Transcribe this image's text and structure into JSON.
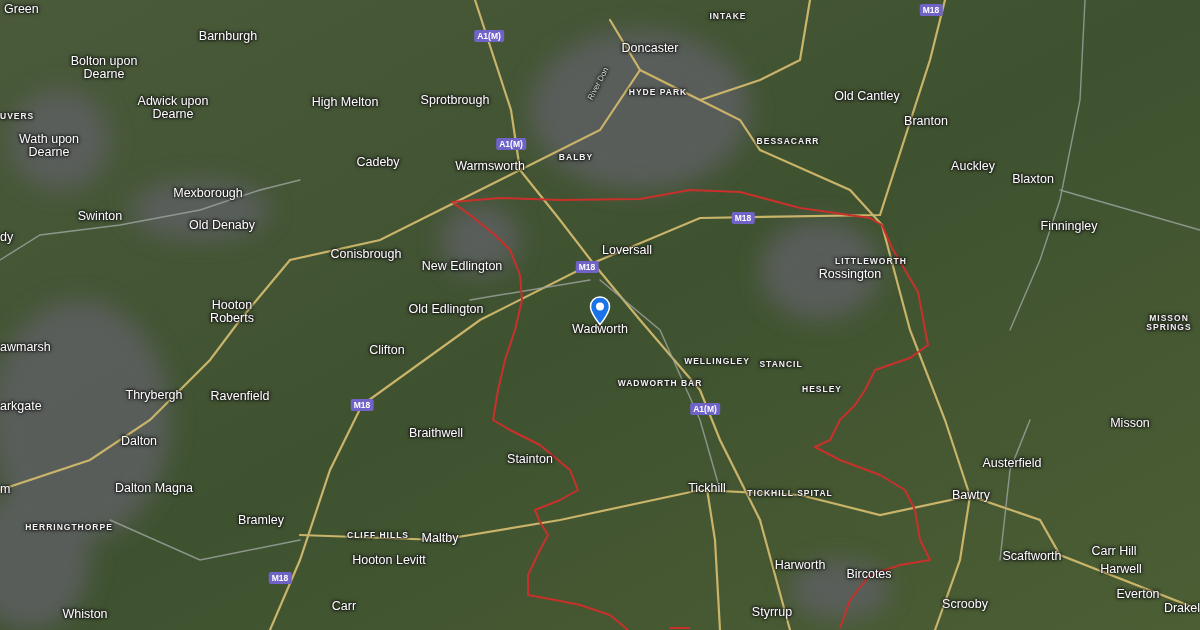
{
  "map": {
    "labels": [
      {
        "text": "Green",
        "kind": "town"
      },
      {
        "text": "Barnburgh",
        "kind": "town"
      },
      {
        "text": "Bolton upon Dearne",
        "kind": "town"
      },
      {
        "text": "UVERS",
        "kind": "district"
      },
      {
        "text": "Adwick upon Dearne",
        "kind": "town"
      },
      {
        "text": "Wath upon Dearne",
        "kind": "town"
      },
      {
        "text": "High Melton",
        "kind": "town"
      },
      {
        "text": "Cadeby",
        "kind": "town"
      },
      {
        "text": "Mexborough",
        "kind": "town"
      },
      {
        "text": "Swinton",
        "kind": "town"
      },
      {
        "text": "Old Denaby",
        "kind": "town"
      },
      {
        "text": "dy",
        "kind": "town"
      },
      {
        "text": "Conisbrough",
        "kind": "town"
      },
      {
        "text": "Hooton Roberts",
        "kind": "town"
      },
      {
        "text": "Sprotbrough",
        "kind": "town"
      },
      {
        "text": "Warmsworth",
        "kind": "town"
      },
      {
        "text": "New Edlington",
        "kind": "town"
      },
      {
        "text": "Old Edlington",
        "kind": "town"
      },
      {
        "text": "Doncaster",
        "kind": "town"
      },
      {
        "text": "River Don",
        "kind": "river"
      },
      {
        "text": "INTAKE",
        "kind": "district"
      },
      {
        "text": "HYDE PARK",
        "kind": "district"
      },
      {
        "text": "BALBY",
        "kind": "district"
      },
      {
        "text": "BESSACARR",
        "kind": "district"
      },
      {
        "text": "Loversall",
        "kind": "town"
      },
      {
        "text": "Wadworth",
        "kind": "town"
      },
      {
        "text": "Old Cantley",
        "kind": "town"
      },
      {
        "text": "Branton",
        "kind": "town"
      },
      {
        "text": "Auckley",
        "kind": "town"
      },
      {
        "text": "Blaxton",
        "kind": "town"
      },
      {
        "text": "Finningley",
        "kind": "town"
      },
      {
        "text": "LITTLEWORTH",
        "kind": "district"
      },
      {
        "text": "Rossington",
        "kind": "town"
      },
      {
        "text": "MISSON SPRINGS",
        "kind": "district"
      },
      {
        "text": "awmarsh",
        "kind": "town"
      },
      {
        "text": "Clifton",
        "kind": "town"
      },
      {
        "text": "Thrybergh",
        "kind": "town"
      },
      {
        "text": "Ravenfield",
        "kind": "town"
      },
      {
        "text": "arkgate",
        "kind": "town"
      },
      {
        "text": "Dalton",
        "kind": "town"
      },
      {
        "text": "m",
        "kind": "town"
      },
      {
        "text": "Dalton Magna",
        "kind": "town"
      },
      {
        "text": "HERRINGTHORPE",
        "kind": "district"
      },
      {
        "text": "Bramley",
        "kind": "town"
      },
      {
        "text": "CLIFF HILLS",
        "kind": "district"
      },
      {
        "text": "Maltby",
        "kind": "town"
      },
      {
        "text": "Hooton Levitt",
        "kind": "town"
      },
      {
        "text": "Carr",
        "kind": "town"
      },
      {
        "text": "Whiston",
        "kind": "town"
      },
      {
        "text": "Braithwell",
        "kind": "town"
      },
      {
        "text": "Stainton",
        "kind": "town"
      },
      {
        "text": "WELLINGLEY",
        "kind": "district"
      },
      {
        "text": "STANCIL",
        "kind": "district"
      },
      {
        "text": "WADWORTH BAR",
        "kind": "district"
      },
      {
        "text": "HESLEY",
        "kind": "district"
      },
      {
        "text": "Tickhill",
        "kind": "town"
      },
      {
        "text": "TICKHILL SPITAL",
        "kind": "district"
      },
      {
        "text": "Harworth",
        "kind": "town"
      },
      {
        "text": "Styrrup",
        "kind": "town"
      },
      {
        "text": "Bircotes",
        "kind": "town"
      },
      {
        "text": "Scrooby",
        "kind": "town"
      },
      {
        "text": "Scaftworth",
        "kind": "town"
      },
      {
        "text": "Carr Hill",
        "kind": "town"
      },
      {
        "text": "Harwell",
        "kind": "town"
      },
      {
        "text": "Everton",
        "kind": "town"
      },
      {
        "text": "Drakel",
        "kind": "town"
      },
      {
        "text": "Bawtry",
        "kind": "town"
      },
      {
        "text": "Austerfield",
        "kind": "town"
      },
      {
        "text": "Misson",
        "kind": "town"
      }
    ],
    "road_shields": [
      {
        "text": "A1(M)"
      },
      {
        "text": "A1(M)"
      },
      {
        "text": "A1(M)"
      },
      {
        "text": "M18"
      },
      {
        "text": "M18"
      },
      {
        "text": "M18"
      },
      {
        "text": "M18"
      },
      {
        "text": "M18"
      }
    ]
  }
}
